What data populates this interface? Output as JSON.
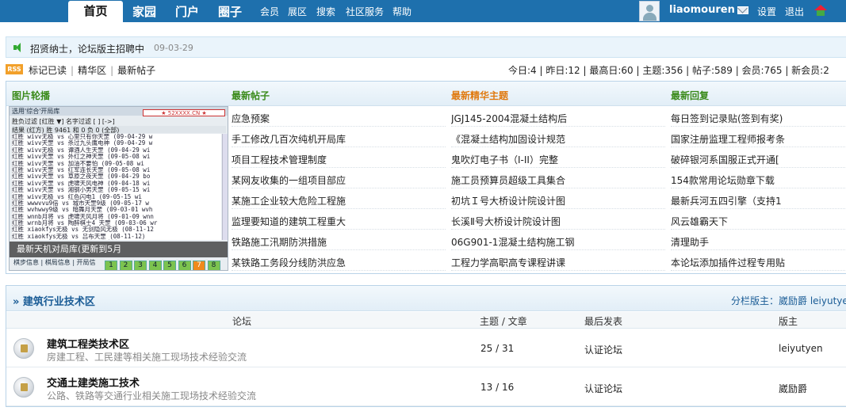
{
  "nav": {
    "home": "首页",
    "items": [
      "家园",
      "门户",
      "圈子"
    ],
    "small_items": [
      "会员",
      "展区",
      "搜索",
      "社区服务",
      "帮助"
    ],
    "username": "liaomouren",
    "settings": "设置",
    "logout": "退出"
  },
  "announcement": {
    "text": "招贤纳士，论坛版主招聘中",
    "date": "09-03-29"
  },
  "quicklinks": [
    "标记已读",
    "精华区",
    "最新帖子"
  ],
  "rss_label": "RSS",
  "stats": {
    "text": "今日:4 | 昨日:12 | 最高日:60 | 主题:356 | 帖子:589 | 会员:765 | 新会员:2"
  },
  "portal": {
    "slideshow_title": "图片轮播",
    "latest_title": "最新帖子",
    "digest_title": "最新精华主题",
    "replies_title": "最新回复",
    "slideshow": {
      "window_title": "选用'综合'开局库",
      "logo": "★ 52XXXX.CN ★",
      "filter": "胜负过滤 [红胜 ▼]   名字过滤 [      ] [->]",
      "header": "结果  (红方) 胜 9461 和 0 负 0 (全部)",
      "rows": [
        "红胜  wivv无极 vs 心里只有你天罡 (09-04-29 w",
        "红胜  wivv天罡 vs 杀过九头鹰电神 (09-04-29 w",
        "红胜  wivv无极 vs 谭酒人生天罡 (09-04-29 wi",
        "红胜  wivv天罡 vs 外红之神天罡 (09-05-08 wi",
        "红胜  wivv天罡 vs 加油不要怕 (09-05-08 wi",
        "红胜  wivv天罡 vs 红军连长天罡 (09-05-08 wi",
        "红胜  wivv天罡 vs 草原之夜天罡 (09-04-29 bo",
        "红胜  wivv天罡 vs 虎啸天风电神 (09-04-18 wi",
        "红胜  wivv天罡 vs 湘钢小男天罡 (09-05-15 wi",
        "红胜  wivv无极 vs 红色闪电1 (09-05-15 wi",
        "红胜  wwwvvu9倍 vs 城市天罡9级 (09-05-17 w",
        "红胜  wvhwwy9级 vs 暗舞月天罡 (09-03-01 wvh",
        "红胜  wnnb月将 vs 虎啸天风月将 (09-01-09 wnn",
        "红胜  wrnb月将 vs 陶醉棋士4 天罡 (09-03-06 wr",
        "红胜  xiaokfys无极 vs 无剑隐风无极 (08-11-12",
        "红胜  xiaokfys无极 vs 吕布天罡 (08-11-12)",
        "红胜  xiaokfys无极 vs 再来再来电神 (08-12-05",
        "红胜  xiaokfys无极 vs 江南雾水北斗 (08-12-0",
        "红胜  xiaokfys无极 vs 胡胡来电天罡 (08-12-0",
        "红胜  xiaokfys天罡 vs 玉女剑无极 (08-11-20)",
        "红胜  xiaokfys天罡 vs 何白云无极 (08-12-05",
        "红胜  xiaokfys天罡 vs 清风一剑无极 (08-12-0"
      ],
      "caption": "最新天机对局库(更新到5月",
      "tabs": "棋步信息 | 棋局信息 | 开局信息",
      "pages": [
        "1",
        "2",
        "3",
        "4",
        "5",
        "6",
        "7",
        "8"
      ],
      "active_page": "7"
    },
    "latest_posts": [
      "应急预案",
      "手工修改几百次纯机开局库",
      "项目工程技术管理制度",
      "某网友收集的一组项目部应",
      "某施工企业较大危险工程施",
      "监理要知道的建筑工程重大",
      "铁路施工汛期防洪措施",
      "某铁路工务段分线防洪应急"
    ],
    "digest_topics": [
      "JGJ145-2004混凝土结构后",
      "《混凝土结构加固设计规范",
      "鬼吹灯电子书（I-II）完整",
      "施工员预算员超级工具集合",
      "初坑Ｉ号大桥设计院设计图",
      "长溪Ⅱ号大桥设计院设计图",
      "06G901-1混凝土结构施工钢",
      "工程力学高职高专课程讲课"
    ],
    "latest_replies": [
      "每日签到记录贴(签到有奖)",
      "国家注册监理工程师报考条",
      "破碎银河系国服正式开通[",
      "154款常用论坛勋章下载",
      "最新兵河五四引擎（支持1",
      "风云雄霸天下",
      "清理助手",
      "本论坛添加插件过程专用贴"
    ]
  },
  "category": {
    "title": "» 建筑行业技术区",
    "moderators_label": "分栏版主：",
    "moderators": "崴励爵  leiyutyen",
    "headers": {
      "forum": "论坛",
      "counts": "主题 / 文章",
      "last_post": "最后发表",
      "moderator": "版主"
    },
    "forums": [
      {
        "name": "建筑工程类技术区",
        "desc": "房建工程、工民建等相关施工现场技术经验交流",
        "counts": "25 / 31",
        "last_post": "认证论坛",
        "moderator": "leiyutyen"
      },
      {
        "name": "交通土建类施工技术",
        "desc": "公路、铁路等交通行业相关施工现场技术经验交流",
        "counts": "13 / 16",
        "last_post": "认证论坛",
        "moderator": "崴励爵"
      }
    ]
  }
}
